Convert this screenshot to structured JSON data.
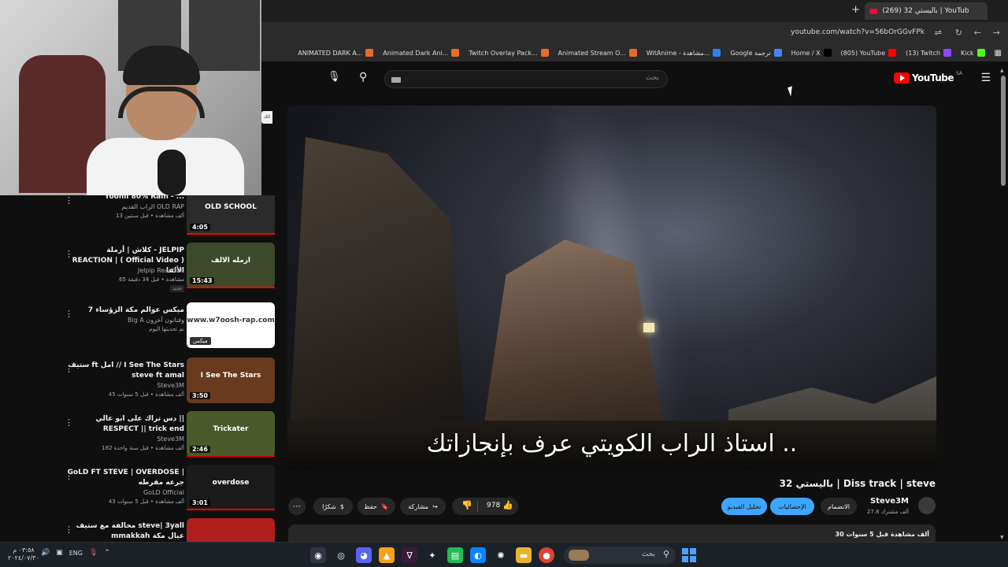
{
  "browser": {
    "tab_title": "(269) 32 باليستي | YouTube - ve",
    "new_tab": "+",
    "close": "×",
    "url": "youtube.com/watch?v=56bOrGGvFPk",
    "bookmarks": [
      {
        "label": "Kick",
        "color": "#53fc18"
      },
      {
        "label": "(13) Twitch",
        "color": "#9146ff"
      },
      {
        "label": "(805) YouTube",
        "color": "#ff0000"
      },
      {
        "label": "Home / X",
        "color": "#000000"
      },
      {
        "label": "Google ترجمة",
        "color": "#4285f4"
      },
      {
        "label": "WitAnime - مشاهدة...",
        "color": "#2f80ed"
      },
      {
        "label": "Animated Stream O...",
        "color": "#e96b2a"
      },
      {
        "label": "Twitch Overlay Pack...",
        "color": "#e96b2a"
      },
      {
        "label": "Animated Dark Ani...",
        "color": "#e96b2a"
      },
      {
        "label": "ANIMATED DARK A...",
        "color": "#e96b2a"
      }
    ]
  },
  "youtube": {
    "logo_text": "YouTube",
    "country_code": "SA",
    "search_placeholder": "بحث"
  },
  "player": {
    "subtitle": "استاذ الراب الكويتي عرف بإنجازاتك .."
  },
  "video": {
    "title": "32 باليستي | Diss track | steve",
    "channel": "Steve3M",
    "subscribers": "27.8 ألف مشترك",
    "join_label": "الانضمام",
    "stats_label": "الإحصائيات",
    "record_label": "تحليل الفيديو",
    "likes": "978",
    "share_label": "مشاركة",
    "save_label": "حفظ",
    "thanks_label": "شكرًا",
    "more_label": "⋯",
    "desc_meta": "30 ألف مشاهدة قبل 5 سنوات"
  },
  "sidebar": {
    "items": [
      {
        "title": "Yoonii 80% Rain - ...",
        "channel": "الراب القديم OLD RAP",
        "meta": "13 ألف مشاهدة • قبل سنتين",
        "duration": "4:05",
        "thumb": "#2b2b2b",
        "thumb_text": "OLD SCHOOL",
        "progress": 1.0,
        "badge": ""
      },
      {
        "title": "كلاش | أرملة - JELPIP REACTION | ( Official Video ) الألفا",
        "channel": "Jelpip Reaction",
        "meta": "65 مشاهدة • قبل 34 دقيقة",
        "duration": "15:43",
        "thumb": "#3d4a2a",
        "thumb_text": "ارمله الالف",
        "progress": 1.0,
        "badge": "جديد"
      },
      {
        "title": "ميكس عوالم مكة الزؤساء 7",
        "channel": "Big A وفنانون آخرون",
        "meta": "تم تحديثها اليوم",
        "duration": "",
        "thumb": "#ffffff",
        "thumb_text": "www.w7oosh-rap.com",
        "progress": 0,
        "badge": "",
        "mix": "ميكس"
      },
      {
        "title": "ستيف ft امل // I See The Stars steve ft amal",
        "channel": "Steve3M",
        "meta": "45 ألف مشاهدة • قبل 5 سنوات",
        "duration": "3:50",
        "thumb": "#6a3a1e",
        "thumb_text": "I See The Stars",
        "progress": 0,
        "badge": ""
      },
      {
        "title": "دس تراك على ابو عالي || RESPECT || trick end",
        "channel": "Steve3M",
        "meta": "182 ألف مشاهدة • قبل سنة واحدة",
        "duration": "2:46",
        "thumb": "#4a5a2a",
        "thumb_text": "Trickater",
        "progress": 1.0,
        "badge": ""
      },
      {
        "title": "GoLD FT STEVE | OVERDOSE | جرعه مفرطه",
        "channel": "GoLD Official",
        "meta": "43 ألف مشاهدة • قبل 5 سنوات",
        "duration": "3:01",
        "thumb": "#1a1a1a",
        "thumb_text": "overdose",
        "progress": 1.0,
        "badge": ""
      },
      {
        "title": "مخالفة مع ستيف steve| 3yall mmakkah عيال مكة",
        "channel": "",
        "meta": "",
        "duration": "",
        "thumb": "#b11e1e",
        "thumb_text": "",
        "progress": 0,
        "badge": ""
      }
    ]
  },
  "taskbar": {
    "time": "٠٣:٥٨ م",
    "date": "٢٠٢٤/٠٧/٣٠",
    "lang": "ENG",
    "search_placeholder": "بحث"
  }
}
